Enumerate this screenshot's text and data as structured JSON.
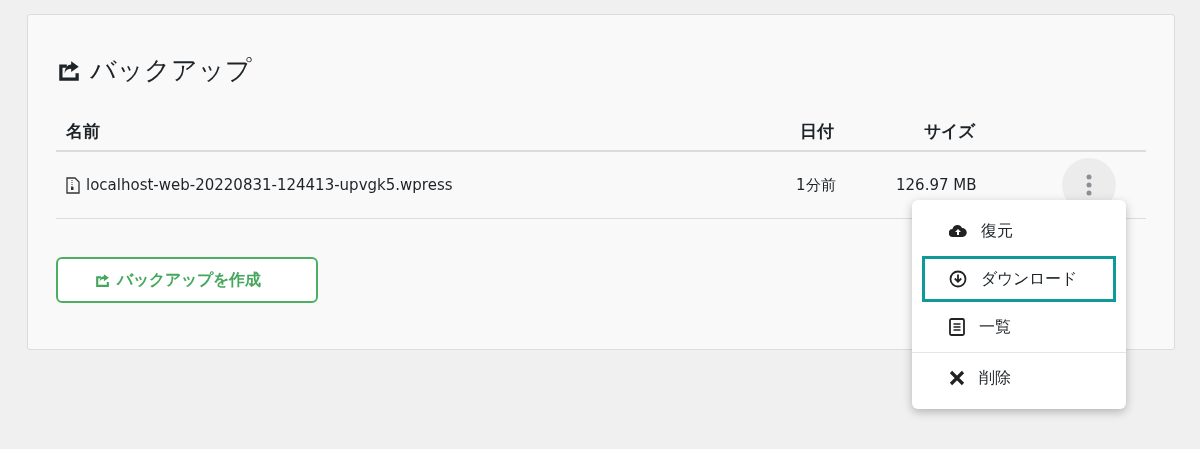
{
  "card": {
    "title": "バックアップ"
  },
  "table": {
    "columns": [
      "名前",
      "日付",
      "サイズ"
    ],
    "rows": [
      {
        "name": "localhost-web-20220831-124413-upvgk5.wpress",
        "date": "1分前",
        "size": "126.97 MB"
      }
    ]
  },
  "menu": {
    "groups": [
      {
        "items": [
          {
            "label": "復元",
            "kind": "restore",
            "highlighted": false
          },
          {
            "label": "ダウンロード",
            "kind": "download",
            "highlighted": true
          },
          {
            "label": "一覧",
            "kind": "list",
            "highlighted": false
          }
        ]
      },
      {
        "items": [
          {
            "label": "削除",
            "kind": "delete",
            "highlighted": false
          }
        ]
      }
    ]
  },
  "create_button": {
    "label": "バックアップを作成"
  }
}
